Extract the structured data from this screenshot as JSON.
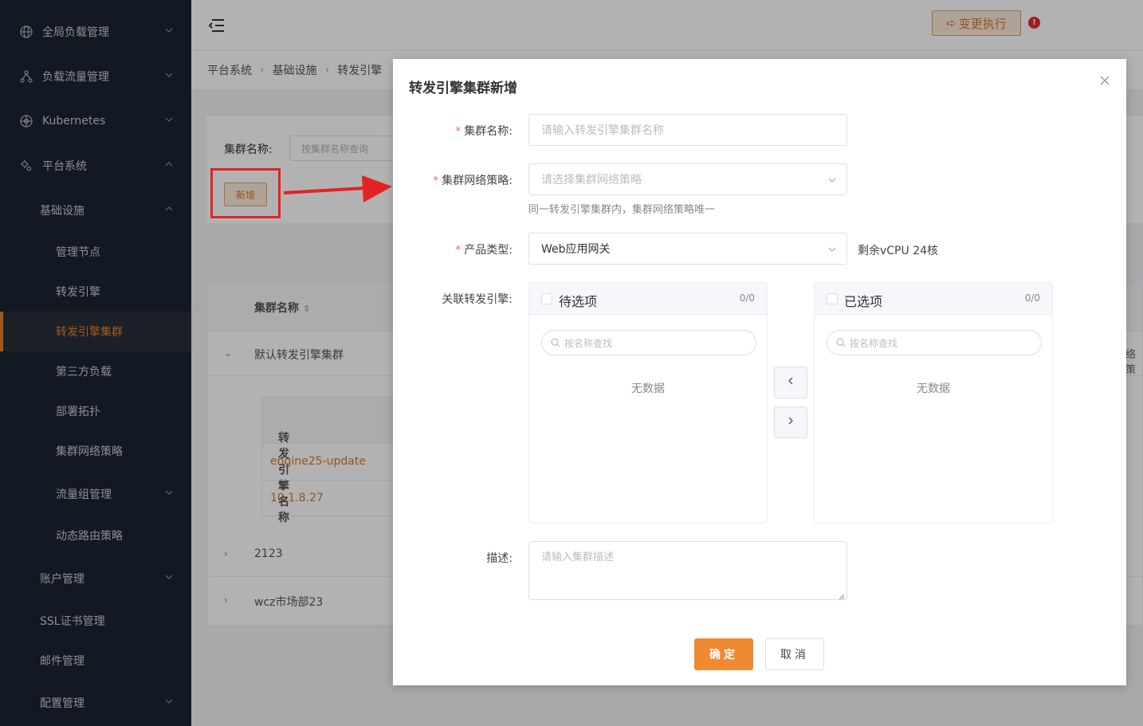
{
  "sidebar": {
    "items": [
      {
        "label": "全局负载管理",
        "icon": "globe-icon"
      },
      {
        "label": "负载流量管理",
        "icon": "network-icon"
      },
      {
        "label": "Kubernetes",
        "icon": "helm-icon"
      },
      {
        "label": "平台系统",
        "icon": "gears-icon"
      },
      {
        "label": "基础设施"
      },
      {
        "label": "管理节点"
      },
      {
        "label": "转发引擎"
      },
      {
        "label": "转发引擎集群"
      },
      {
        "label": "第三方负载"
      },
      {
        "label": "部署拓扑"
      },
      {
        "label": "集群网络策略"
      },
      {
        "label": "流量组管理"
      },
      {
        "label": "动态路由策略"
      },
      {
        "label": "账户管理"
      },
      {
        "label": "SSL证书管理"
      },
      {
        "label": "邮件管理"
      },
      {
        "label": "配置管理"
      }
    ]
  },
  "header": {
    "exec_label": "变更执行",
    "alert_mark": "!"
  },
  "breadcrumb": [
    "平台系统",
    "基础设施",
    "转发引擎"
  ],
  "filter": {
    "label": "集群名称:",
    "placeholder": "按集群名称查询",
    "add_label": "新增"
  },
  "table": {
    "header": "集群名称",
    "rows": [
      "默认转发引擎集群",
      "2123",
      "wcz市场部23"
    ],
    "sub_header": "转发引擎名称",
    "sub_rows": [
      "engine25-update",
      "10.1.8.27"
    ],
    "right_cut": "络策"
  },
  "modal": {
    "title": "转发引擎集群新增",
    "name_label": "集群名称:",
    "name_placeholder": "请输入转发引擎集群名称",
    "policy_label": "集群网络策略:",
    "policy_placeholder": "请选择集群网络策略",
    "policy_hint": "同一转发引擎集群内，集群网络策略唯一",
    "product_label": "产品类型:",
    "product_value": "Web应用网关",
    "remaining": "剩余vCPU 24核",
    "assoc_label": "关联转发引擎:",
    "left_panel": {
      "title": "待选项",
      "count": "0/0",
      "search_placeholder": "按名称查找",
      "empty": "无数据"
    },
    "right_panel": {
      "title": "已选项",
      "count": "0/0",
      "search_placeholder": "按名称查找",
      "empty": "无数据"
    },
    "desc_label": "描述:",
    "desc_placeholder": "请输入集群描述",
    "ok_label": "确定",
    "cancel_label": "取消"
  },
  "colors": {
    "accent": "#ef8a33",
    "sidebar_bg": "#1c2433",
    "annotation_red": "#e52222"
  }
}
